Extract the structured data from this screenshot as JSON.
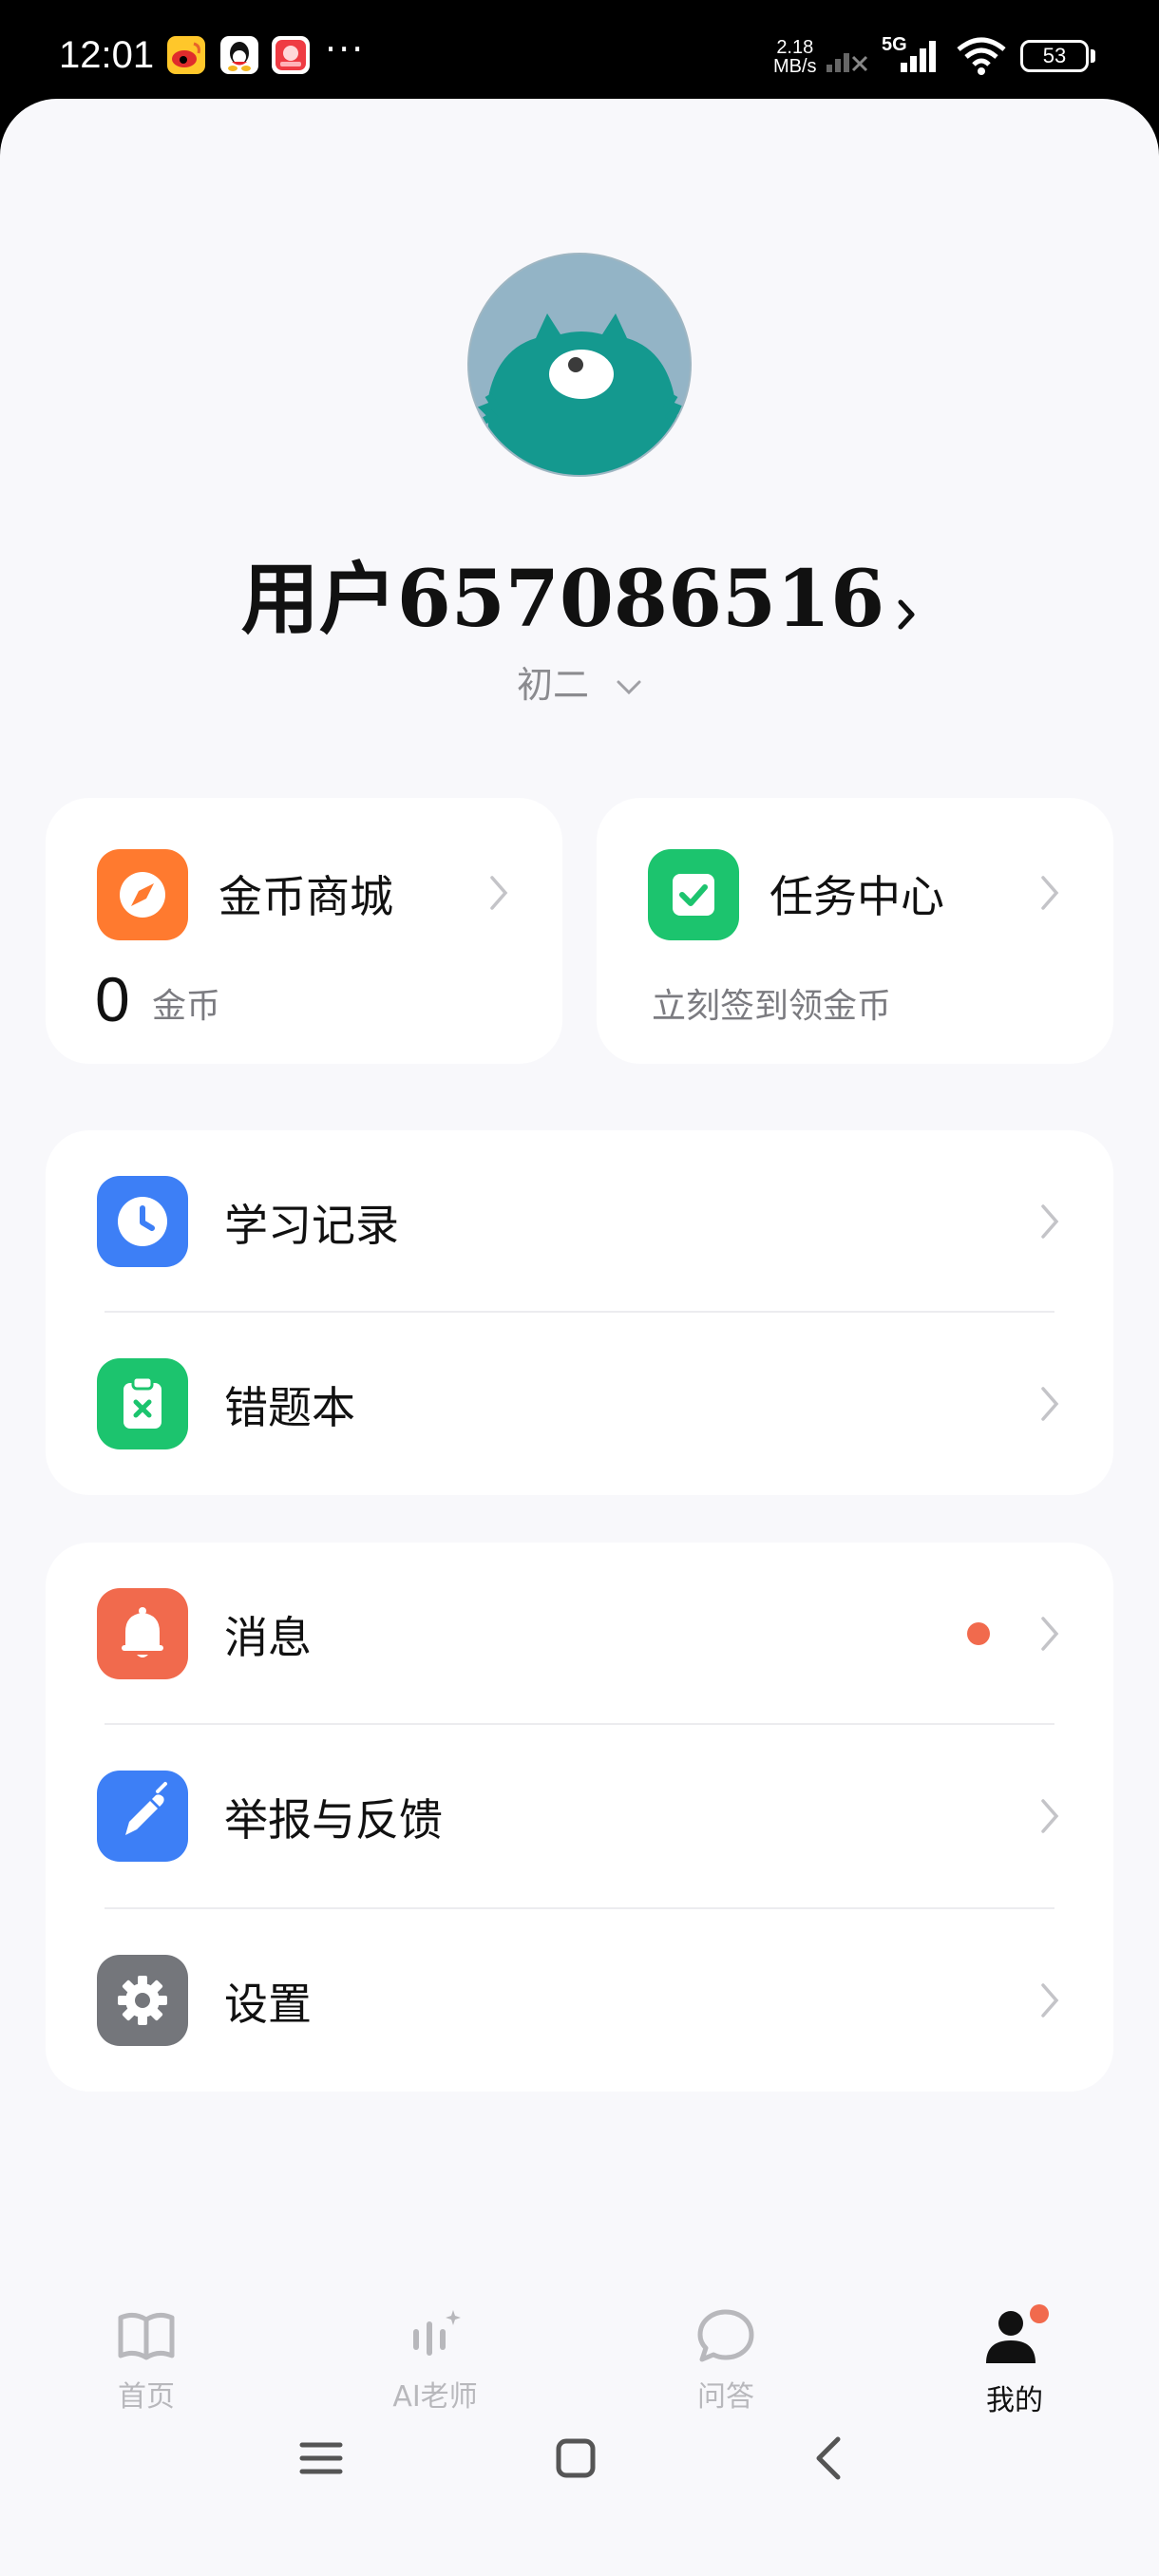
{
  "status_bar": {
    "time": "12:01",
    "network_speed_value": "2.18",
    "network_speed_unit": "MB/s",
    "network_type": "5G",
    "battery": "53",
    "notification_icons": [
      "weibo-icon",
      "qq-icon",
      "red-app-icon"
    ],
    "more": "···"
  },
  "profile": {
    "username": "用户657086516",
    "grade": "初二"
  },
  "cards": {
    "coin_mall": {
      "title": "金币商城",
      "coin_count": "0",
      "coin_unit": "金币",
      "icon": "compass-icon",
      "color": "#ff7a2f"
    },
    "task_center": {
      "title": "任务中心",
      "subtitle": "立刻签到领金币",
      "icon": "check-icon",
      "color": "#1cc46e"
    }
  },
  "study_section": {
    "items": [
      {
        "label": "学习记录",
        "icon": "clock-icon",
        "color": "#3d7ff6"
      },
      {
        "label": "错题本",
        "icon": "clipboard-x-icon",
        "color": "#1cc46e"
      }
    ]
  },
  "misc_section": {
    "items": [
      {
        "label": "消息",
        "icon": "bell-icon",
        "color": "#f16a4d",
        "unread": true
      },
      {
        "label": "举报与反馈",
        "icon": "pen-icon",
        "color": "#3d7ff6"
      },
      {
        "label": "设置",
        "icon": "gear-icon",
        "color": "#74767b"
      }
    ]
  },
  "bottom_nav": {
    "items": [
      {
        "label": "首页",
        "icon": "book-icon",
        "active": false
      },
      {
        "label": "AI老师",
        "icon": "ai-voice-icon",
        "active": false
      },
      {
        "label": "问答",
        "icon": "chat-bubble-icon",
        "active": false
      },
      {
        "label": "我的",
        "icon": "user-icon",
        "active": true
      }
    ]
  }
}
